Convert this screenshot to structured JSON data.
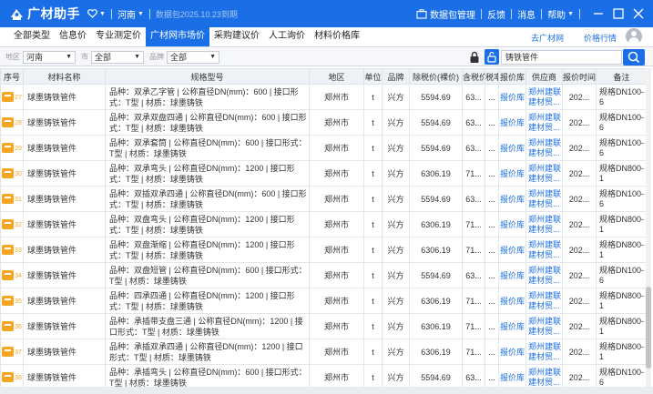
{
  "titlebar": {
    "app_name": "广材助手",
    "region": "河南",
    "expire_text": "数据包2025.10.23到期",
    "package_manage": "数据包管理",
    "feedback": "反馈",
    "messages": "消息",
    "help": "帮助"
  },
  "tabs": [
    {
      "label": "全部类型"
    },
    {
      "label": "信息价"
    },
    {
      "label": "专业测定价"
    },
    {
      "label": "广材网市场价"
    },
    {
      "label": "采购建议价"
    },
    {
      "label": "人工询价"
    },
    {
      "label": "材料价格库"
    }
  ],
  "tab_links": {
    "goto_site": "去广材网",
    "price_trend": "价格行情"
  },
  "filters": {
    "region_label": "地区",
    "region_value": "河南",
    "city_label": "市",
    "city_value": "全部",
    "brand_label": "品牌",
    "brand_value": "全部",
    "search_value": "铸铁管件"
  },
  "table": {
    "headers": [
      "序号",
      "材料名称",
      "规格型号",
      "地区",
      "单位",
      "品牌",
      "除税价(裸价)",
      "含税价",
      "税率",
      "报价库",
      "供应商",
      "报价时间",
      "备注"
    ],
    "rows": [
      {
        "no": "27",
        "name": "球墨铸铁管件",
        "spec": "品种：双承乙字管 | 公称直径DN(mm)：600 | 接口形式：T型 | 材质：球墨铸铁",
        "region": "郑州市",
        "unit": "t",
        "brand": "兴方",
        "price": "5594.69",
        "tax_price": "63...",
        "rate": "...",
        "lib": "报价库",
        "supplier": "郑州建联建材贸...",
        "time": "202...",
        "note": "规格DN100-6"
      },
      {
        "no": "28",
        "name": "球墨铸铁管件",
        "spec": "品种：双承双盘四通 | 公称直径DN(mm)：600 | 接口形式：T型 | 材质：球墨铸铁",
        "region": "郑州市",
        "unit": "t",
        "brand": "兴方",
        "price": "5594.69",
        "tax_price": "63...",
        "rate": "...",
        "lib": "报价库",
        "supplier": "郑州建联建材贸...",
        "time": "202...",
        "note": "规格DN100-6"
      },
      {
        "no": "29",
        "name": "球墨铸铁管件",
        "spec": "品种：双承套筒 | 公称直径DN(mm)：600 | 接口形式：T型 | 材质：球墨铸铁",
        "region": "郑州市",
        "unit": "t",
        "brand": "兴方",
        "price": "5594.69",
        "tax_price": "63...",
        "rate": "...",
        "lib": "报价库",
        "supplier": "郑州建联建材贸...",
        "time": "202...",
        "note": "规格DN100-6"
      },
      {
        "no": "30",
        "name": "球墨铸铁管件",
        "spec": "品种：双承弯头 | 公称直径DN(mm)：1200 | 接口形式：T型 | 材质：球墨铸铁",
        "region": "郑州市",
        "unit": "t",
        "brand": "兴方",
        "price": "6306.19",
        "tax_price": "71...",
        "rate": "...",
        "lib": "报价库",
        "supplier": "郑州建联建材贸...",
        "time": "202...",
        "note": "规格DN800-1"
      },
      {
        "no": "31",
        "name": "球墨铸铁管件",
        "spec": "品种：双插双承四通 | 公称直径DN(mm)：600 | 接口形式：T型 | 材质：球墨铸铁",
        "region": "郑州市",
        "unit": "t",
        "brand": "兴方",
        "price": "5594.69",
        "tax_price": "63...",
        "rate": "...",
        "lib": "报价库",
        "supplier": "郑州建联建材贸...",
        "time": "202...",
        "note": "规格DN100-6"
      },
      {
        "no": "32",
        "name": "球墨铸铁管件",
        "spec": "品种：双盘弯头 | 公称直径DN(mm)：1200 | 接口形式：T型 | 材质：球墨铸铁",
        "region": "郑州市",
        "unit": "t",
        "brand": "兴方",
        "price": "6306.19",
        "tax_price": "71...",
        "rate": "...",
        "lib": "报价库",
        "supplier": "郑州建联建材贸...",
        "time": "202...",
        "note": "规格DN800-1"
      },
      {
        "no": "33",
        "name": "球墨铸铁管件",
        "spec": "品种：双盘渐缩 | 公称直径DN(mm)：1200 | 接口形式：T型 | 材质：球墨铸铁",
        "region": "郑州市",
        "unit": "t",
        "brand": "兴方",
        "price": "6306.19",
        "tax_price": "71...",
        "rate": "...",
        "lib": "报价库",
        "supplier": "郑州建联建材贸...",
        "time": "202...",
        "note": "规格DN800-1"
      },
      {
        "no": "34",
        "name": "球墨铸铁管件",
        "spec": "品种：双盘短管 | 公称直径DN(mm)：600 | 接口形式：T型 | 材质：球墨铸铁",
        "region": "郑州市",
        "unit": "t",
        "brand": "兴方",
        "price": "5594.69",
        "tax_price": "63...",
        "rate": "...",
        "lib": "报价库",
        "supplier": "郑州建联建材贸...",
        "time": "202...",
        "note": "规格DN100-6"
      },
      {
        "no": "35",
        "name": "球墨铸铁管件",
        "spec": "品种：四承四通 | 公称直径DN(mm)：1200 | 接口形式：T型 | 材质：球墨铸铁",
        "region": "郑州市",
        "unit": "t",
        "brand": "兴方",
        "price": "6306.19",
        "tax_price": "71...",
        "rate": "...",
        "lib": "报价库",
        "supplier": "郑州建联建材贸...",
        "time": "202...",
        "note": "规格DN800-1"
      },
      {
        "no": "36",
        "name": "球墨铸铁管件",
        "spec": "品种：承插带支盘三通 | 公称直径DN(mm)：1200 | 接口形式：T型 | 材质：球墨铸铁",
        "region": "郑州市",
        "unit": "t",
        "brand": "兴方",
        "price": "6306.19",
        "tax_price": "71...",
        "rate": "...",
        "lib": "报价库",
        "supplier": "郑州建联建材贸...",
        "time": "202...",
        "note": "规格DN800-1"
      },
      {
        "no": "37",
        "name": "球墨铸铁管件",
        "spec": "品种：承插双承四通 | 公称直径DN(mm)：1200 | 接口形式：T型 | 材质：球墨铸铁",
        "region": "郑州市",
        "unit": "t",
        "brand": "兴方",
        "price": "6306.19",
        "tax_price": "71...",
        "rate": "...",
        "lib": "报价库",
        "supplier": "郑州建联建材贸...",
        "time": "202...",
        "note": "规格DN800-1"
      },
      {
        "no": "38",
        "name": "球墨铸铁管件",
        "spec": "品种：承插弯头 | 公称直径DN(mm)：600 | 接口形式：T型 | 材质：球墨铸铁",
        "region": "郑州市",
        "unit": "t",
        "brand": "兴方",
        "price": "5594.69",
        "tax_price": "63...",
        "rate": "...",
        "lib": "报价库",
        "supplier": "郑州建联建材贸...",
        "time": "202...",
        "note": "规格DN100-6"
      }
    ]
  },
  "colors": {
    "brand_blue": "#1a6fe6",
    "row_tag_orange": "#f5a623",
    "link_blue": "#1a6fe6"
  },
  "icons": [
    "logo-icon",
    "heart-icon",
    "package-icon",
    "minimize-icon",
    "maximize-icon",
    "close-icon",
    "lock-icon",
    "unlock-icon",
    "search-icon",
    "user-avatar-icon"
  ]
}
